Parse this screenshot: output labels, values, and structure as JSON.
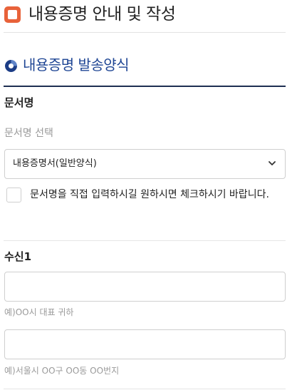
{
  "header": {
    "title": "내용증명 안내 및 작성",
    "icon": "square-logo-icon",
    "icon_color": "#e8623a"
  },
  "section": {
    "title": "내용증명 발송양식",
    "title_color": "#1e4594",
    "icon": "ring-icon"
  },
  "document": {
    "label": "문서명",
    "select_placeholder": "문서명 선택",
    "selected_value": "내용증명서(일반양식)",
    "custom_checkbox_label": "문서명을 직접 입력하시길 원하시면 체크하시기 바랍니다.",
    "custom_checked": false
  },
  "recipient": {
    "label": "수신1",
    "name_value": "",
    "name_hint": "예)OO시 대표 귀하",
    "address_value": "",
    "address_hint": "예)서울시 OO구 OO동 OO번지"
  }
}
